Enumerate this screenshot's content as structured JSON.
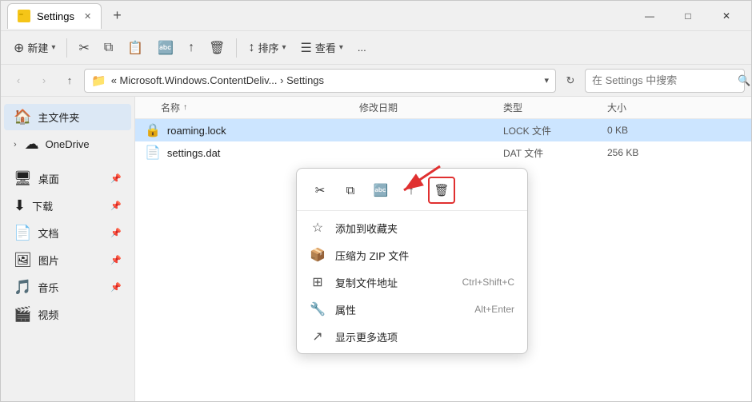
{
  "window": {
    "title": "Settings",
    "tab_close": "✕",
    "tab_new": "+",
    "controls": {
      "minimize": "—",
      "maximize": "□",
      "close": "✕"
    }
  },
  "toolbar": {
    "new_label": "新建",
    "cut_icon": "✂",
    "copy_icon": "⧉",
    "paste_icon": "📋",
    "rename_icon": "🔤",
    "share_icon": "↑",
    "delete_icon": "🗑",
    "sort_label": "排序",
    "view_label": "查看",
    "more_icon": "..."
  },
  "address_bar": {
    "path": "« Microsoft.Windows.ContentDeliv... › Settings",
    "search_placeholder": "在 Settings 中搜索"
  },
  "sidebar": {
    "items": [
      {
        "label": "主文件夹",
        "icon": "🏠"
      },
      {
        "label": "OneDrive",
        "icon": "☁"
      },
      {
        "label": "桌面",
        "icon": "🖥"
      },
      {
        "label": "下载",
        "icon": "⬇"
      },
      {
        "label": "文档",
        "icon": "📄"
      },
      {
        "label": "图片",
        "icon": "🖼"
      },
      {
        "label": "音乐",
        "icon": "🎵"
      },
      {
        "label": "视频",
        "icon": "🎬"
      }
    ]
  },
  "file_list": {
    "headers": [
      "名称",
      "修改日期",
      "类型",
      "大小"
    ],
    "files": [
      {
        "name": "roaming.lock",
        "date": "",
        "type": "LOCK 文件",
        "size": "0 KB"
      },
      {
        "name": "settings.dat",
        "date": "",
        "type": "DAT 文件",
        "size": "256 KB"
      }
    ]
  },
  "context_menu": {
    "toolbar_icons": [
      "✂",
      "⧉",
      "🔤",
      "↑"
    ],
    "delete_icon": "🗑",
    "items": [
      {
        "icon": "☆",
        "label": "添加到收藏夹",
        "shortcut": ""
      },
      {
        "icon": "📦",
        "label": "压缩为 ZIP 文件",
        "shortcut": ""
      },
      {
        "icon": "⊞",
        "label": "复制文件地址",
        "shortcut": "Ctrl+Shift+C"
      },
      {
        "icon": "🔧",
        "label": "属性",
        "shortcut": "Alt+Enter"
      },
      {
        "icon": "↗",
        "label": "显示更多选项",
        "shortcut": ""
      }
    ]
  }
}
